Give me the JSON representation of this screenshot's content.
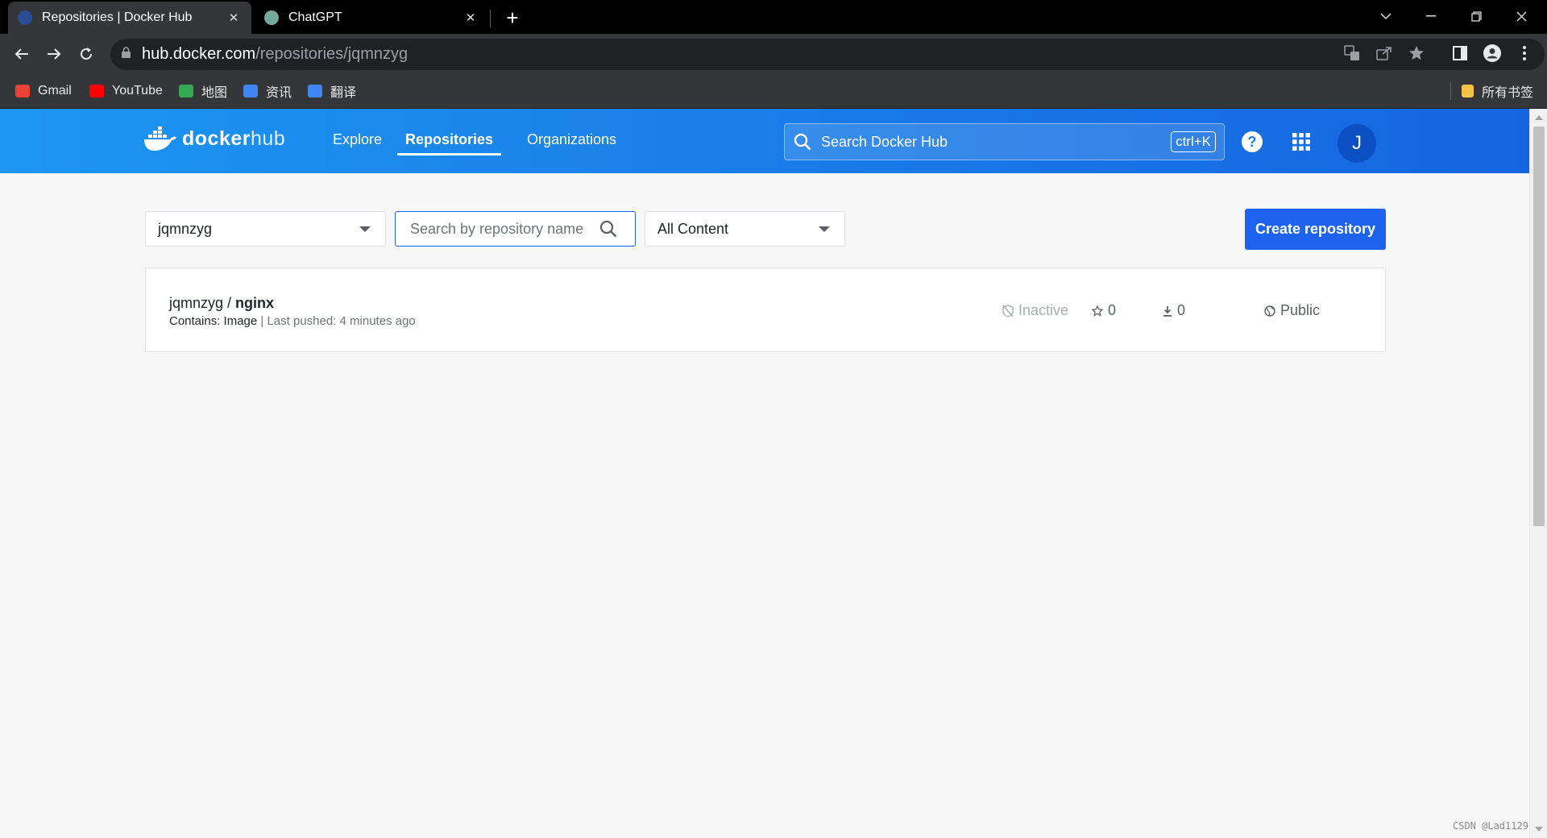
{
  "browser": {
    "tabs": [
      {
        "title": "Repositories | Docker Hub",
        "active": true
      },
      {
        "title": "ChatGPT",
        "active": false
      }
    ],
    "url_host": "hub.docker.com",
    "url_path": "/repositories/jqmnzyg",
    "bookmarks": [
      {
        "label": "Gmail",
        "icon": "gmail-icon",
        "color": "#ea4335"
      },
      {
        "label": "YouTube",
        "icon": "youtube-icon",
        "color": "#ff0000"
      },
      {
        "label": "地图",
        "icon": "maps-icon",
        "color": "#34a853"
      },
      {
        "label": "资讯",
        "icon": "news-icon",
        "color": "#4285f4"
      },
      {
        "label": "翻译",
        "icon": "translate-icon",
        "color": "#4285f4"
      }
    ],
    "bookmarks_folder": "所有书签"
  },
  "dockerhub": {
    "brand_docker": "docker",
    "brand_hub": "hub",
    "nav": [
      {
        "label": "Explore",
        "active": false
      },
      {
        "label": "Repositories",
        "active": true
      },
      {
        "label": "Organizations",
        "active": false
      }
    ],
    "search_placeholder": "Search Docker Hub",
    "search_shortcut": "ctrl+K",
    "avatar_initial": "J",
    "accent_color": "#1d63ed"
  },
  "filters": {
    "namespace": "jqmnzyg",
    "repo_search_placeholder": "Search by repository name",
    "content_filter": "All Content",
    "create_button": "Create repository"
  },
  "repositories": [
    {
      "namespace": "jqmnzyg",
      "separator": " / ",
      "name": "nginx",
      "contains_label": "Contains: Image",
      "pushed_label": "Last pushed: 4 minutes ago",
      "status": "Inactive",
      "stars": "0",
      "pulls": "0",
      "visibility": "Public"
    }
  ],
  "watermark": "CSDN @Lad1129"
}
